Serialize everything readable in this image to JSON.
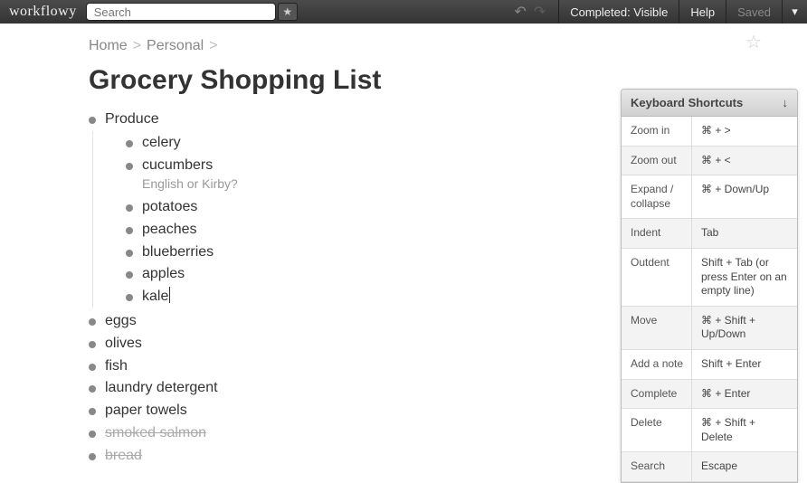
{
  "app": {
    "name": "workflowy"
  },
  "search": {
    "placeholder": "Search"
  },
  "topbar": {
    "completed": "Completed: Visible",
    "help": "Help",
    "saved": "Saved"
  },
  "breadcrumb": {
    "items": [
      "Home",
      "Personal"
    ]
  },
  "title": "Grocery Shopping List",
  "outline": [
    {
      "text": "Produce",
      "children": [
        {
          "text": "celery"
        },
        {
          "text": "cucumbers",
          "note": "English or Kirby?"
        },
        {
          "text": "potatoes"
        },
        {
          "text": "peaches"
        },
        {
          "text": "blueberries"
        },
        {
          "text": "apples"
        },
        {
          "text": "kale",
          "cursor": true
        }
      ]
    },
    {
      "text": "eggs"
    },
    {
      "text": "olives"
    },
    {
      "text": "fish"
    },
    {
      "text": "laundry detergent"
    },
    {
      "text": "paper towels"
    },
    {
      "text": "smoked salmon",
      "completed": true
    },
    {
      "text": "bread",
      "completed": true
    }
  ],
  "shortcuts": {
    "title": "Keyboard Shortcuts",
    "rows": [
      {
        "name": "Zoom in",
        "key": "⌘ + >"
      },
      {
        "name": "Zoom out",
        "key": "⌘ + <"
      },
      {
        "name": "Expand / collapse",
        "key": "⌘ + Down/Up"
      },
      {
        "name": "Indent",
        "key": "Tab"
      },
      {
        "name": "Outdent",
        "key": "Shift + Tab\n(or press Enter on an empty line)"
      },
      {
        "name": "Move",
        "key": "⌘ + Shift + Up/Down"
      },
      {
        "name": "Add a note",
        "key": "Shift + Enter"
      },
      {
        "name": "Complete",
        "key": "⌘ + Enter"
      },
      {
        "name": "Delete",
        "key": "⌘ + Shift + Delete"
      },
      {
        "name": "Search",
        "key": "Escape"
      }
    ]
  }
}
